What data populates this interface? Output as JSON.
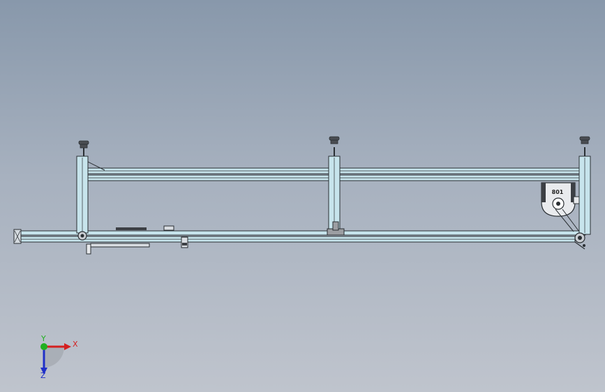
{
  "model": {
    "part_label": "801"
  },
  "triad": {
    "x_label": "X",
    "y_label": "Y",
    "z_label": "Z",
    "x_color": "#d42020",
    "y_color": "#20b020",
    "z_color": "#2030c8"
  },
  "colors": {
    "profile_fill": "#c7e4ec",
    "profile_edge": "#2a2f33",
    "foot_fill": "#4a4d52",
    "plate_fill": "#9c9ea2",
    "housing_fill": "#e9ebee"
  }
}
